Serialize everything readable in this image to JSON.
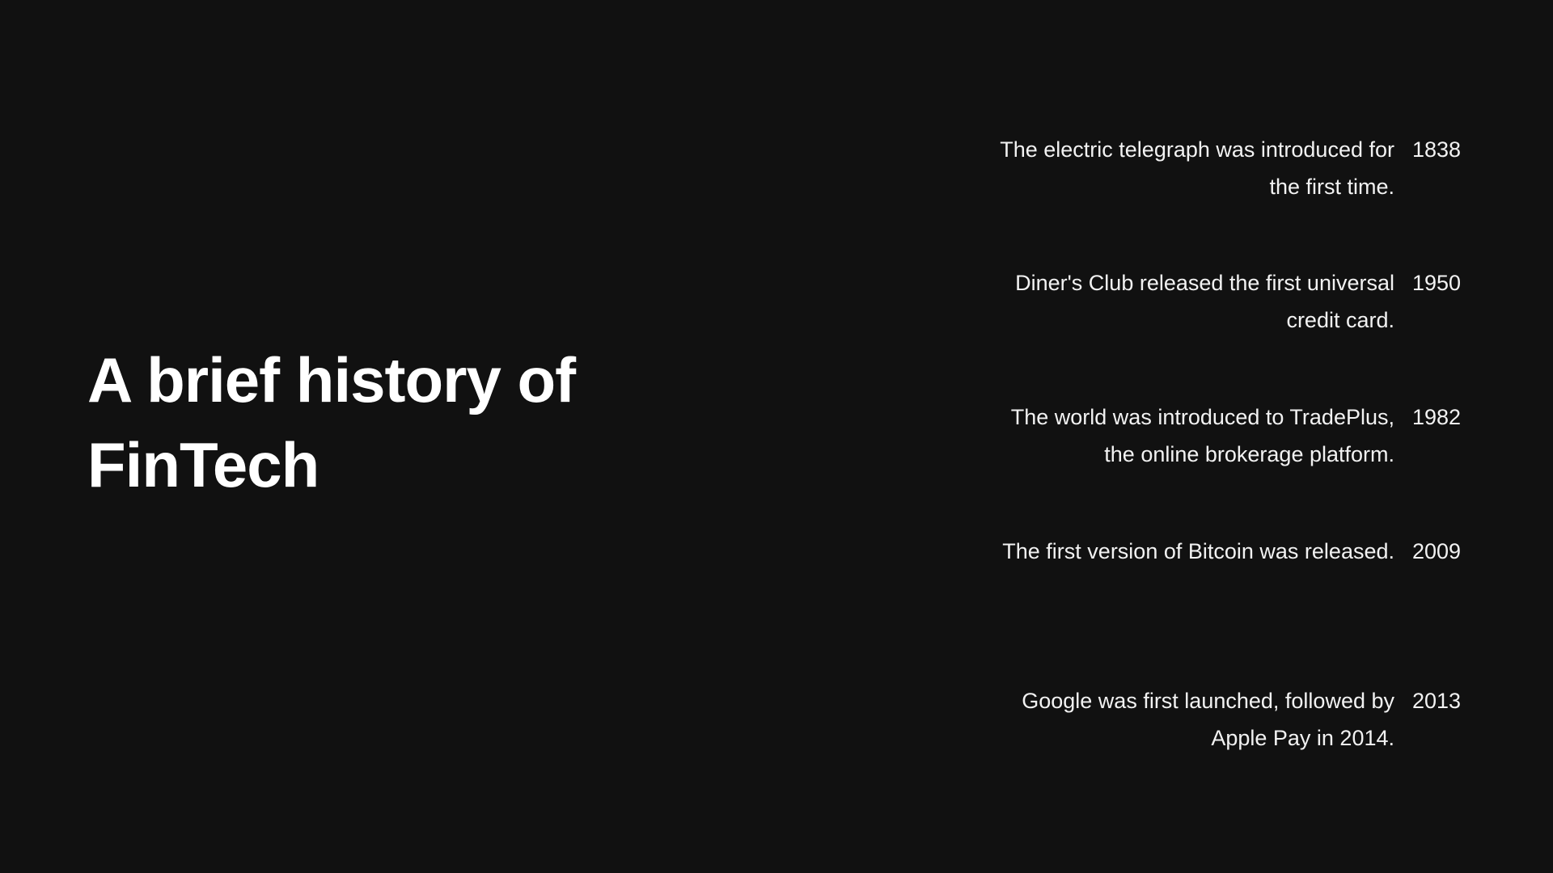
{
  "title": "A brief history of FinTech",
  "events": [
    {
      "text": "The electric telegraph was introduced for\nthe first time.",
      "year": "1838"
    },
    {
      "text": "Diner's Club released the first universal\ncredit card. ",
      "year": "1950"
    },
    {
      "text": "The world was introduced to TradePlus,\nthe online brokerage platform.",
      "year": "1982"
    },
    {
      "text": "The first version of Bitcoin was released.",
      "year": "2009"
    },
    {
      "text": "Google was first launched, followed by\nApple Pay in 2014.",
      "year": "2013"
    }
  ]
}
